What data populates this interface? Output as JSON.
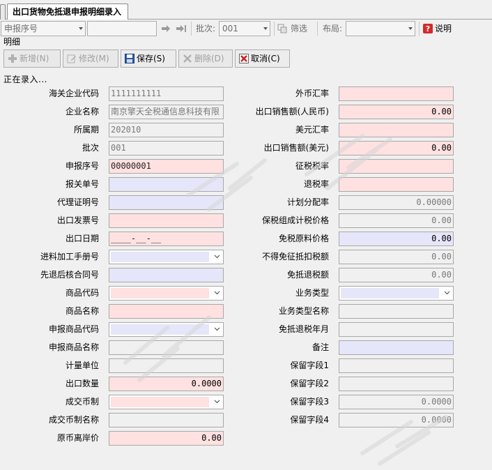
{
  "tab": {
    "title": "出口货物免抵退申报明细录入"
  },
  "toolbar": {
    "sort_field": "申报序号",
    "search_value": "",
    "batch_label": "批次:",
    "batch_value": "001",
    "filter_label": "筛选",
    "layout_label": "布局:",
    "layout_value": "",
    "help_label": "说明"
  },
  "section_title": "明细",
  "actions": {
    "add": "新增(N)",
    "edit": "修改(M)",
    "save": "保存(S)",
    "delete": "删除(D)",
    "cancel": "取消(C)"
  },
  "status_text": "正在录入...",
  "left": {
    "customs_code": {
      "label": "海关企业代码",
      "value": "1111111111"
    },
    "company_name": {
      "label": "企业名称",
      "value": "南京擎天全税通信息科技有限"
    },
    "period": {
      "label": "所属期",
      "value": "202010"
    },
    "batch": {
      "label": "批次",
      "value": "001"
    },
    "seq_no": {
      "label": "申报序号",
      "value": "00000001"
    },
    "customs_decl_no": {
      "label": "报关单号",
      "value": ""
    },
    "agent_cert_no": {
      "label": "代理证明号",
      "value": ""
    },
    "invoice_no": {
      "label": "出口发票号",
      "value": ""
    },
    "export_date": {
      "label": "出口日期",
      "value": "____-__-__"
    },
    "processing_manual_no": {
      "label": "进料加工手册号",
      "value": ""
    },
    "verification_contract_no": {
      "label": "先退后核合同号",
      "value": ""
    },
    "commodity_code": {
      "label": "商品代码",
      "value": ""
    },
    "commodity_name": {
      "label": "商品名称",
      "value": ""
    },
    "decl_commodity_code": {
      "label": "申报商品代码",
      "value": ""
    },
    "decl_commodity_name": {
      "label": "申报商品名称",
      "value": ""
    },
    "unit": {
      "label": "计量单位",
      "value": ""
    },
    "export_qty": {
      "label": "出口数量",
      "value": "0.0000"
    },
    "currency": {
      "label": "成交币制",
      "value": ""
    },
    "currency_name": {
      "label": "成交币制名称",
      "value": ""
    },
    "fob_price": {
      "label": "原币离岸价",
      "value": "0.00"
    }
  },
  "right": {
    "fx_rate": {
      "label": "外币汇率",
      "value": ""
    },
    "sales_rmb": {
      "label": "出口销售额(人民币)",
      "value": "0.00"
    },
    "usd_rate": {
      "label": "美元汇率",
      "value": ""
    },
    "sales_usd": {
      "label": "出口销售额(美元)",
      "value": "0.00"
    },
    "levy_rate": {
      "label": "征税税率",
      "value": ""
    },
    "refund_rate": {
      "label": "退税率",
      "value": ""
    },
    "plan_alloc_rate": {
      "label": "计划分配率",
      "value": "0.00000"
    },
    "bonded_tax_price": {
      "label": "保税组成计税价格",
      "value": "0.00"
    },
    "dutyfree_material_price": {
      "label": "免税原料价格",
      "value": "0.00"
    },
    "non_deductible": {
      "label": "不得免征抵扣税额",
      "value": "0.00"
    },
    "exempt_refund_tax": {
      "label": "免抵退税额",
      "value": "0.00"
    },
    "business_type": {
      "label": "业务类型",
      "value": ""
    },
    "business_type_name": {
      "label": "业务类型名称",
      "value": ""
    },
    "refund_period": {
      "label": "免抵退税年月",
      "value": ""
    },
    "remark": {
      "label": "备注",
      "value": ""
    },
    "reserved1": {
      "label": "保留字段1",
      "value": ""
    },
    "reserved2": {
      "label": "保留字段2",
      "value": ""
    },
    "reserved3": {
      "label": "保留字段3",
      "value": "0.0000"
    },
    "reserved4": {
      "label": "保留字段4",
      "value": "0.0000"
    }
  },
  "colors": {
    "required": "#ffe1e1",
    "optional": "#e6e6fa",
    "readonly": "#f0f0f0"
  }
}
